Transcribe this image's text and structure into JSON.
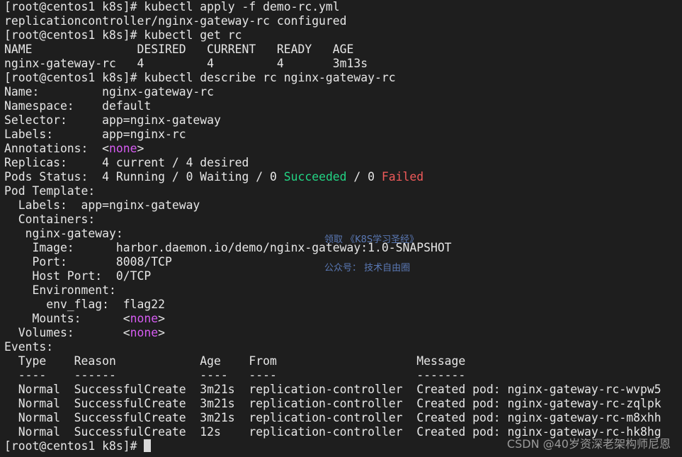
{
  "lines": [
    [
      "[root@centos1 k8s]# kubectl apply -f demo-rc.yml"
    ],
    [
      "replicationcontroller/nginx-gateway-rc configured"
    ],
    [
      "[root@centos1 k8s]# kubectl get rc"
    ],
    [
      "NAME               DESIRED   CURRENT   READY   AGE"
    ],
    [
      "nginx-gateway-rc   4         4         4       3m13s"
    ],
    [
      "[root@centos1 k8s]# kubectl describe rc nginx-gateway-rc"
    ],
    [
      "Name:         nginx-gateway-rc"
    ],
    [
      "Namespace:    default"
    ],
    [
      "Selector:     app=nginx-gateway"
    ],
    [
      "Labels:       app=nginx-rc"
    ],
    [
      "Annotations:  <",
      "none",
      ">"
    ],
    [
      "Replicas:     4 current / 4 desired"
    ],
    [
      "Pods Status:  4 Running / 0 Waiting / 0 ",
      "Succeeded",
      " / 0 ",
      "Failed"
    ],
    [
      "Pod Template:"
    ],
    [
      "  Labels:  app=nginx-gateway"
    ],
    [
      "  Containers:"
    ],
    [
      "   nginx-gateway:"
    ],
    [
      "    Image:      harbor.daemon.io/demo/nginx-gateway:1.0-SNAPSHOT"
    ],
    [
      "    Port:       8008/TCP"
    ],
    [
      "    Host Port:  0/TCP"
    ],
    [
      "    Environment:"
    ],
    [
      "      env_flag:  flag22"
    ],
    [
      "    Mounts:      <",
      "none",
      ">"
    ],
    [
      "  Volumes:       <",
      "none",
      ">"
    ],
    [
      "Events:"
    ],
    [
      "  Type    Reason            Age    From                    Message"
    ],
    [
      "  ----    ------            ----   ----                    -------"
    ],
    [
      "  Normal  SuccessfulCreate  3m21s  replication-controller  Created pod: nginx-gateway-rc-wvpw5"
    ],
    [
      "  Normal  SuccessfulCreate  3m21s  replication-controller  Created pod: nginx-gateway-rc-zqlpk"
    ],
    [
      "  Normal  SuccessfulCreate  3m21s  replication-controller  Created pod: nginx-gateway-rc-m8xhh"
    ],
    [
      "  Normal  SuccessfulCreate  12s    replication-controller  Created pod: nginx-gateway-rc-hk8hg"
    ],
    [
      "[root@centos1 k8s]# "
    ]
  ],
  "watermark": {
    "line1": "领取 《K8S学习圣经》",
    "line2": "公众号： 技术自由圈"
  },
  "footer": "CSDN @40岁资深老架构师尼恩",
  "colors": {
    "none": "#d65cf2",
    "succeeded": "#22d484",
    "failed": "#f05a5a",
    "background": "#1e1e1e"
  }
}
